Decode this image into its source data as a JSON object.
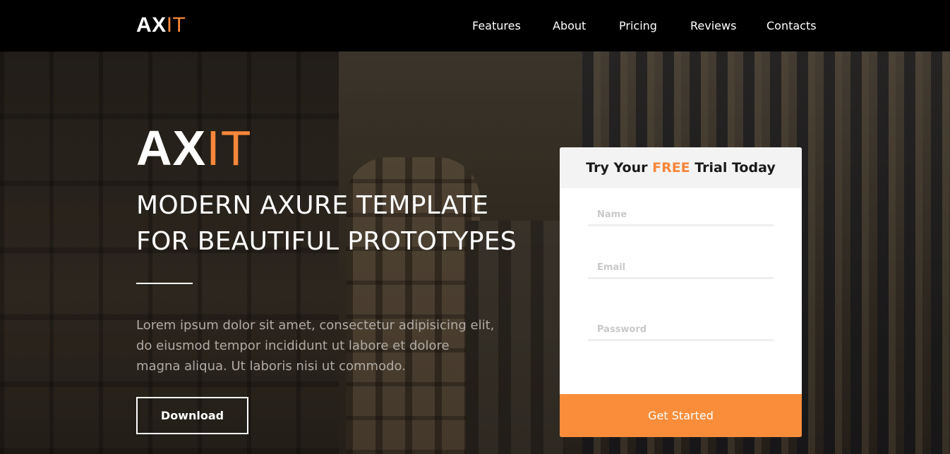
{
  "nav": {
    "logo_ax": "AX",
    "logo_it": "IT",
    "links": [
      "Features",
      "About",
      "Pricing",
      "Reviews",
      "Contacts"
    ]
  },
  "hero": {
    "logo_ax": "AX",
    "logo_it": "IT",
    "headline_line1": "MODERN AXURE TEMPLATE",
    "headline_line2": "FOR BEAUTIFUL PROTOTYPES",
    "body_text": "Lorem ipsum dolor sit amet, consectetur adipisicing elit, do eiusmod tempor incididunt ut labore et dolore magna aliqua. Ut laboris nisi ut commodo.",
    "download_label": "Download"
  },
  "signup": {
    "title_pre": "Try Your ",
    "title_highlight": "FREE",
    "title_post": " Trial Today",
    "name_placeholder": "Name",
    "email_placeholder": "Email",
    "password_placeholder": "Password",
    "submit_label": "Get Started"
  },
  "colors": {
    "accent": "#f7873a",
    "button_accent": "#f98d3a",
    "nav_bg": "#000000"
  }
}
